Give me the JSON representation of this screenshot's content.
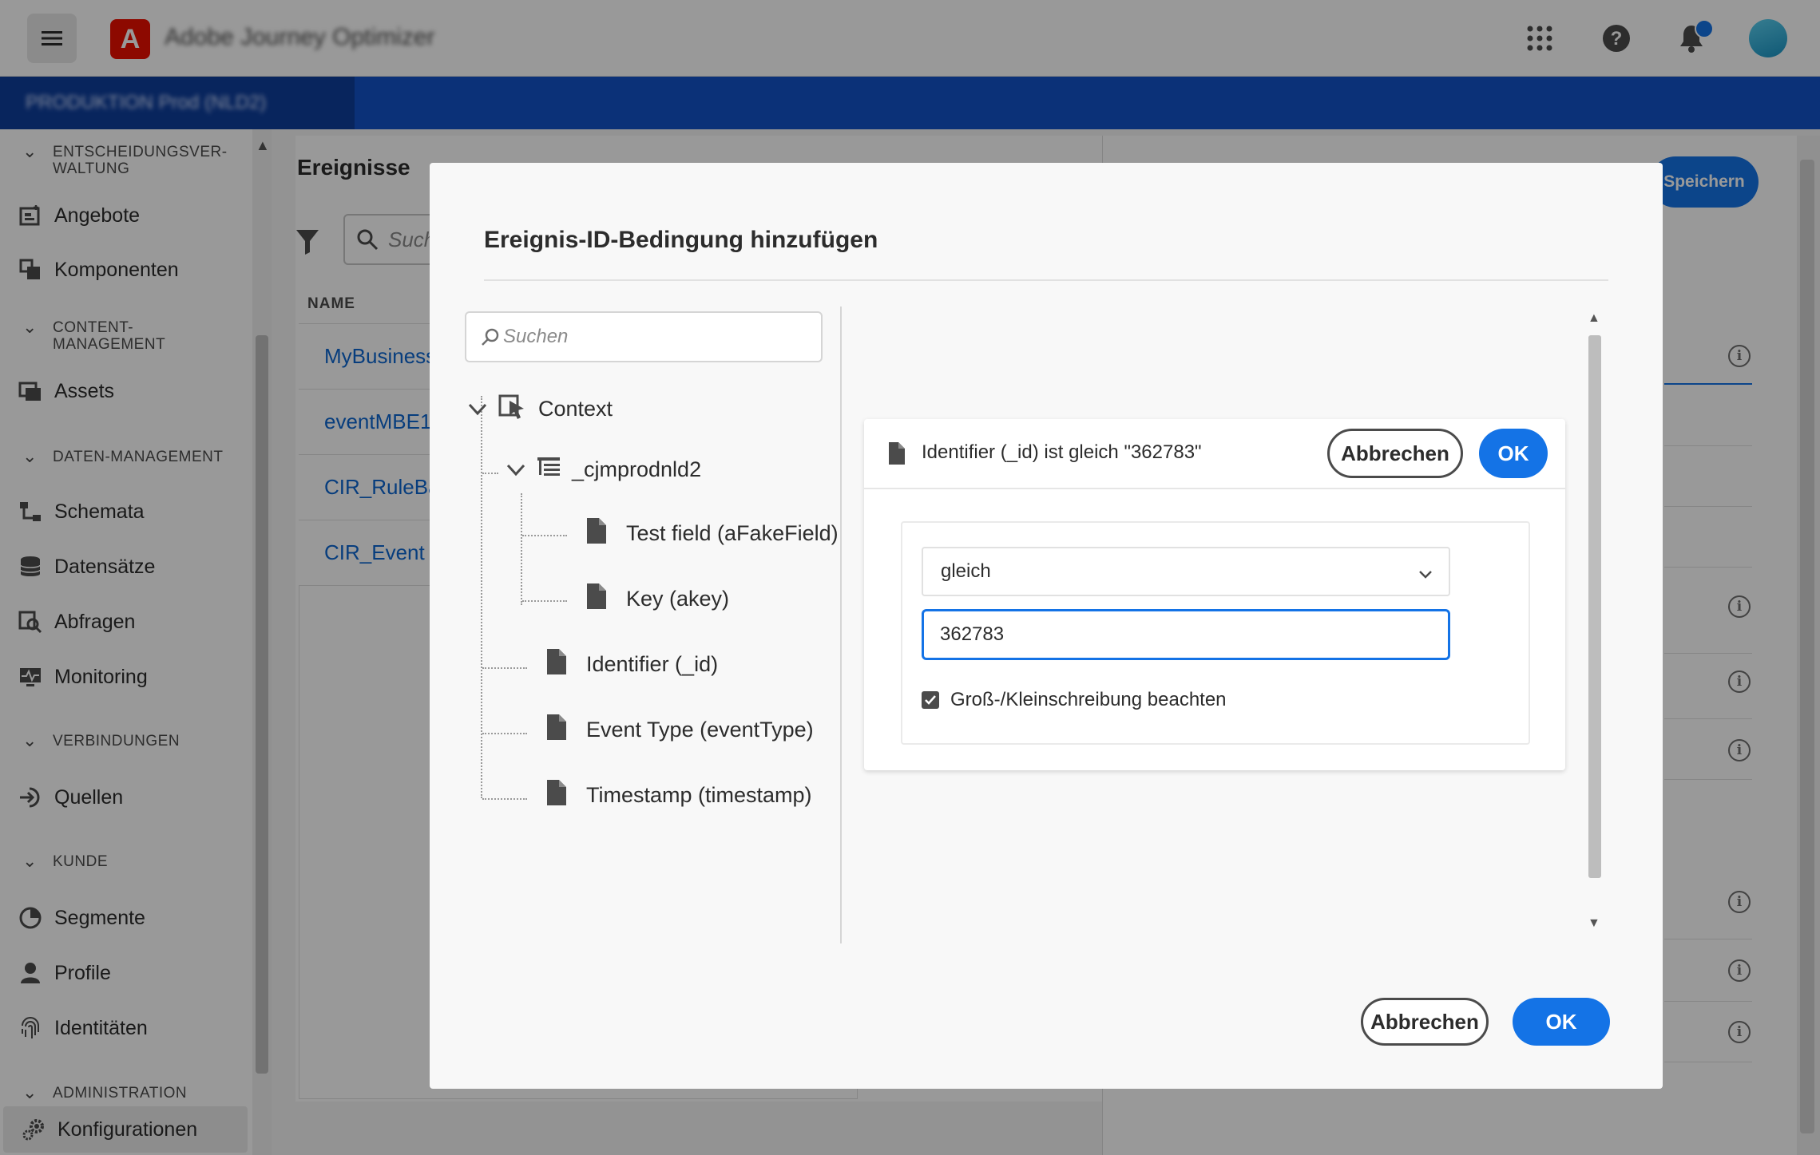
{
  "header": {
    "app_title": "Adobe Journey Optimizer",
    "logo_letter": "A"
  },
  "orgbar": {
    "org_label": "PRODUKTION  Prod (NLD2)"
  },
  "sidebar": {
    "sections": {
      "decisioning": "ENTSCHEIDUNGSVER-\nWALTUNG",
      "content": "CONTENT-\nMANAGEMENT",
      "data": "DATEN-MANAGEMENT",
      "connections": "VERBINDUNGEN",
      "customer": "KUNDE",
      "admin": "ADMINISTRATION"
    },
    "items": {
      "offers": "Angebote",
      "components": "Komponenten",
      "assets": "Assets",
      "schemas": "Schemata",
      "datasets": "Datensätze",
      "queries": "Abfragen",
      "monitoring": "Monitoring",
      "sources": "Quellen",
      "segments": "Segmente",
      "profiles": "Profile",
      "identities": "Identitäten",
      "configurations": "Konfigurationen"
    }
  },
  "main": {
    "title": "Ereignisse",
    "search_placeholder": "Suche",
    "column_name": "NAME",
    "events": [
      "MyBusiness",
      "eventMBE1",
      "CIR_RuleBa",
      "CIR_Event"
    ],
    "save_label": "Speichern"
  },
  "dialog": {
    "title": "Ereignis-ID-Bedingung hinzufügen",
    "search_placeholder": "Suchen",
    "tree": {
      "context": "Context",
      "namespace": "_cjmprodnld2",
      "test_field": "Test field (aFakeField)",
      "key": "Key (akey)",
      "identifier": "Identifier (_id)",
      "event_type": "Event Type (eventType)",
      "timestamp": "Timestamp (timestamp)"
    },
    "cancel_label": "Abbrechen",
    "ok_label": "OK"
  },
  "condition": {
    "summary": "Identifier (_id) ist gleich \"362783\"",
    "cancel_label": "Abbrechen",
    "ok_label": "OK",
    "operator": "gleich",
    "value": "362783",
    "case_sensitive_label": "Groß-/Kleinschreibung beachten",
    "case_sensitive": true
  },
  "colors": {
    "accent": "#1473e6",
    "orgbar": "#1352c9",
    "logo": "#eb1000"
  }
}
